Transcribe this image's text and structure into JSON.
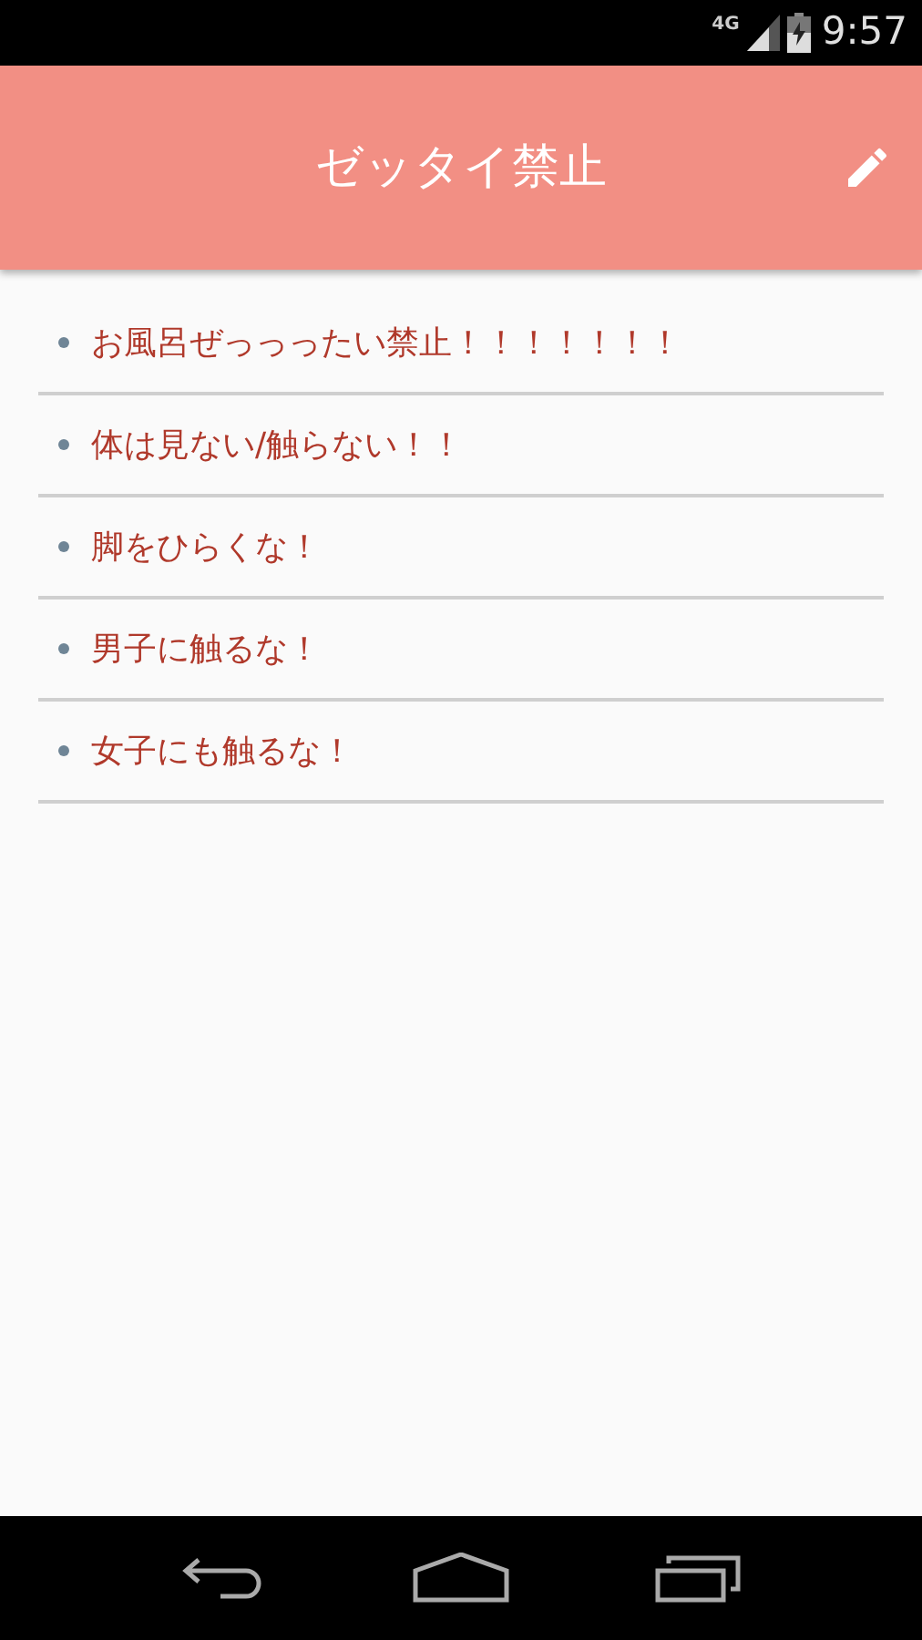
{
  "status_bar": {
    "network": "4G",
    "time": "9:57"
  },
  "app_bar": {
    "title": "ゼッタイ禁止"
  },
  "rules": [
    {
      "text": "お風呂ぜっっったい禁止！！！！！！！"
    },
    {
      "text": "体は見ない/触らない！！"
    },
    {
      "text": "脚をひらくな！"
    },
    {
      "text": "男子に触るな！"
    },
    {
      "text": "女子にも触るな！"
    }
  ]
}
